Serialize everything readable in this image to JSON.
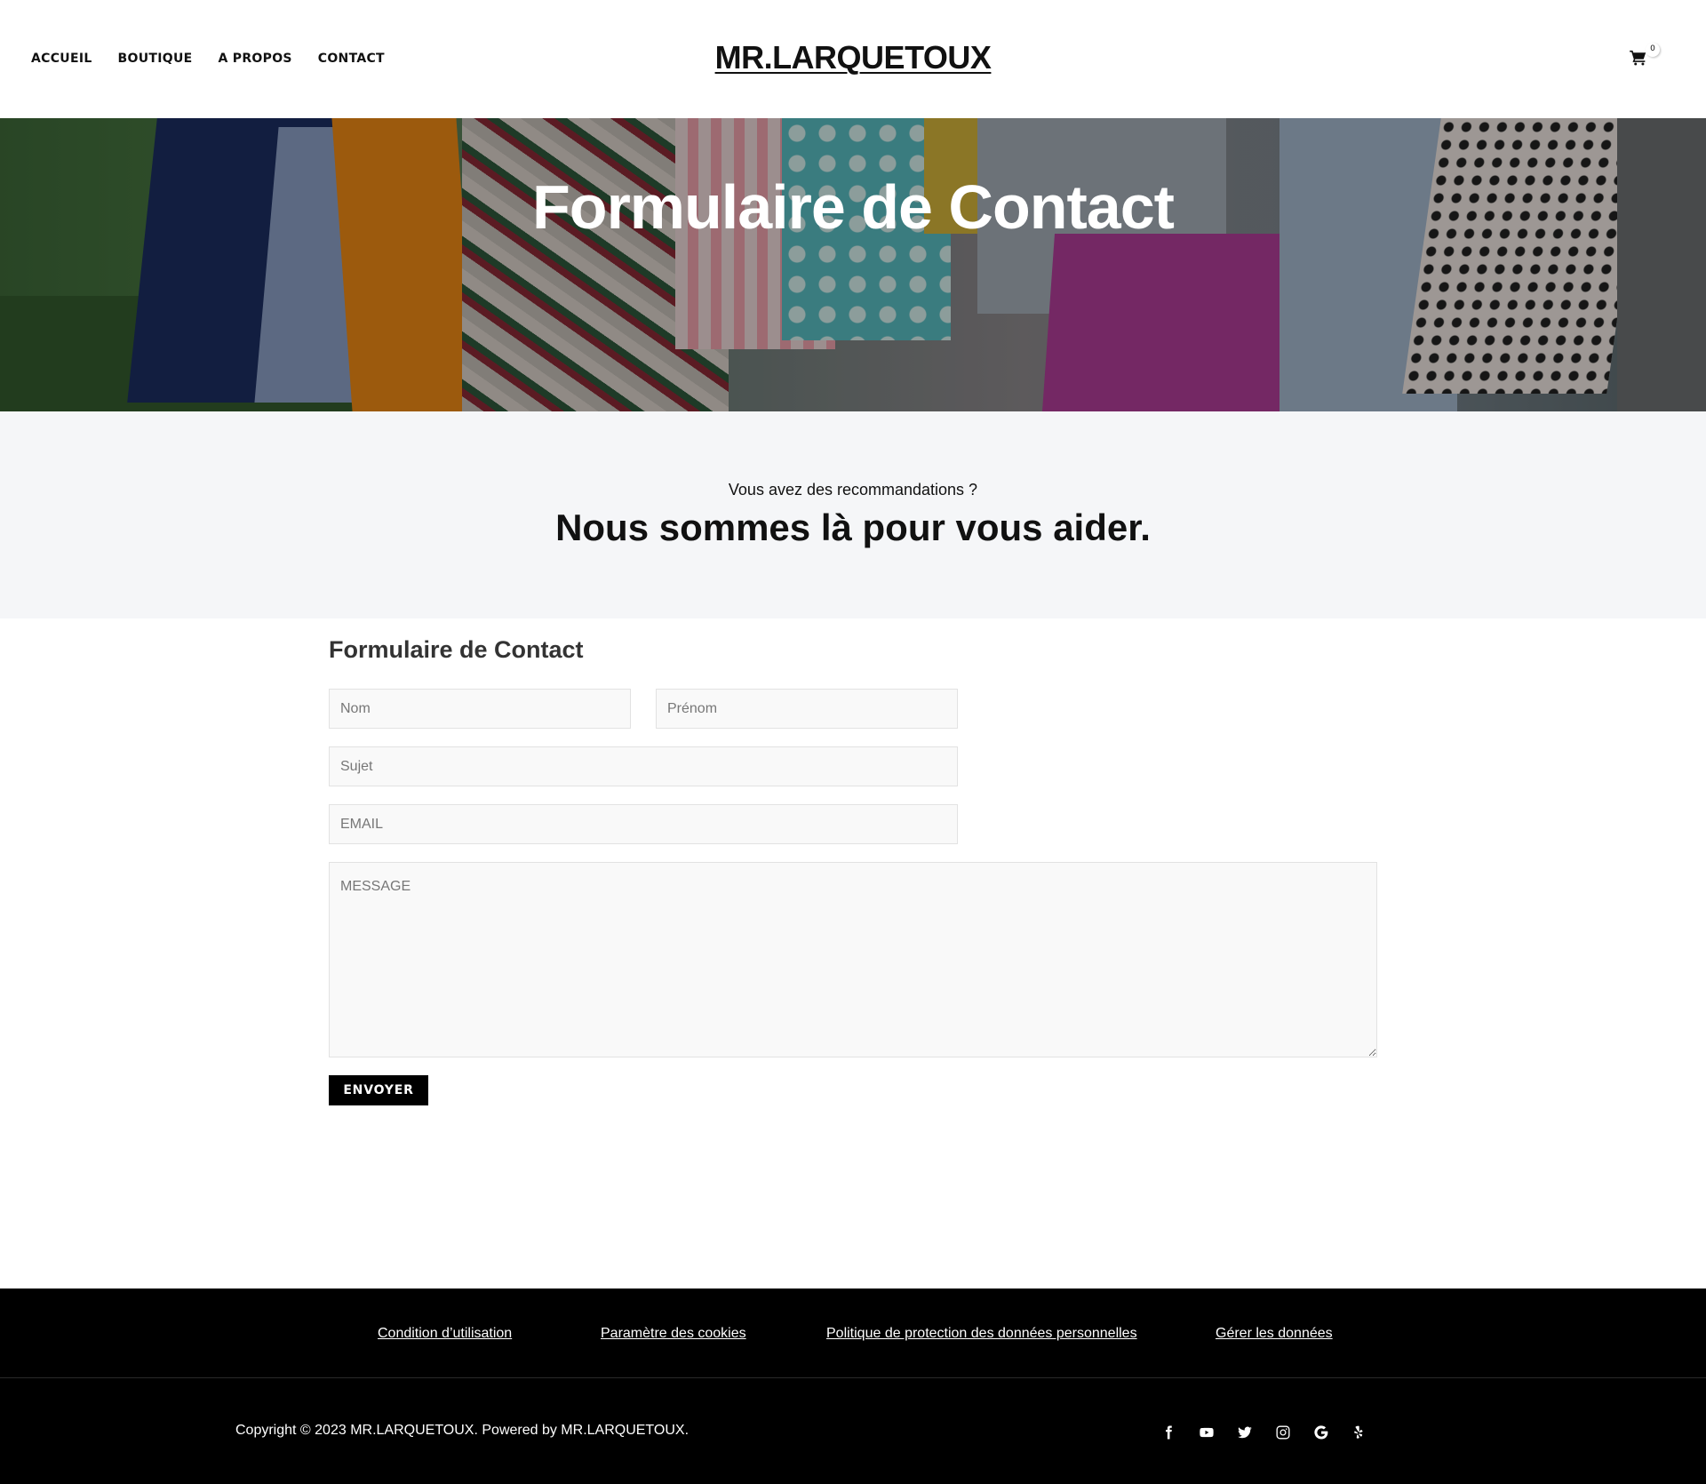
{
  "nav": {
    "items": [
      {
        "label": "ACCUEIL"
      },
      {
        "label": "BOUTIQUE"
      },
      {
        "label": "A PROPOS"
      },
      {
        "label": "CONTACT"
      }
    ]
  },
  "brand": {
    "logo": "MR.LARQUETOUX"
  },
  "cart": {
    "count": "0",
    "icon": "cart-icon"
  },
  "hero": {
    "title": "Formulaire de Contact"
  },
  "intro": {
    "subtitle": "Vous avez des recommandations ?",
    "title": "Nous sommes là pour vous aider."
  },
  "form": {
    "title": "Formulaire de Contact",
    "nom_placeholder": "Nom",
    "prenom_placeholder": "Prénom",
    "sujet_placeholder": "Sujet",
    "email_placeholder": "EMAIL",
    "message_placeholder": "MESSAGE",
    "submit_label": "ENVOYER"
  },
  "footer": {
    "links": [
      {
        "label": "Condition d’utilisation"
      },
      {
        "label": "Paramètre des cookies"
      },
      {
        "label": "Politique de protection des données personnelles"
      },
      {
        "label": "Gérer les données"
      }
    ],
    "copyright": "Copyright © 2023 MR.LARQUETOUX. Powered by MR.LARQUETOUX.",
    "social": [
      "facebook-icon",
      "youtube-icon",
      "twitter-icon",
      "instagram-icon",
      "google-icon",
      "yelp-icon"
    ]
  }
}
